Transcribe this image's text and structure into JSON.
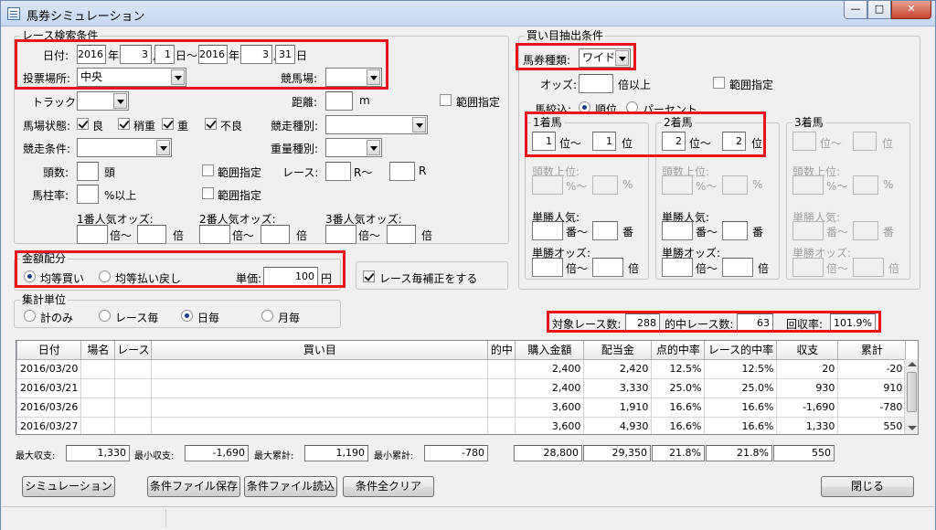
{
  "window": {
    "title": "馬券シミュレーション",
    "min": "—",
    "max": "□",
    "close": "✕"
  },
  "race_search": {
    "title": "レース検索条件",
    "date_label": "日付:",
    "from_year": "2016",
    "year_unit": "年",
    "from_month": "3",
    "month_unit": "月",
    "from_day": "1",
    "day_unit_tilde": "日〜",
    "to_year": "2016",
    "to_month": "3",
    "to_day": "31",
    "day_unit": "日",
    "venue_label": "投票場所:",
    "venue_value": "中央",
    "course_label": "競馬場:",
    "course_value": "",
    "track_label": "トラック:",
    "track_value": "",
    "distance_label": "距離:",
    "distance_value": "",
    "distance_unit": "m",
    "range_label": "範囲指定",
    "condition_label": "馬場状態:",
    "cond_good": "良",
    "cond_slightly": "稍重",
    "cond_heavy": "重",
    "cond_bad": "不良",
    "race_type_label": "競走種別:",
    "race_type_value": "",
    "race_cond_label": "競走条件:",
    "race_cond_value": "",
    "weight_type_label": "重量種別:",
    "weight_type_value": "",
    "heads_label": "頭数:",
    "heads_value": "",
    "heads_unit": "頭",
    "heads_range": "範囲指定",
    "race_label": "レース:",
    "race_from": "",
    "race_r_tilde": "R〜",
    "race_to": "",
    "race_r": "R",
    "post_rate_label": "馬柱率:",
    "post_rate_value": "",
    "post_rate_unit": "%以上",
    "post_range": "範囲指定",
    "fav1_label": "1番人気オッズ:",
    "fav2_label": "2番人気オッズ:",
    "fav3_label": "3番人気オッズ:",
    "bai_tilde": "倍〜",
    "bai": "倍"
  },
  "amount": {
    "title": "金額配分",
    "equal_buy": "均等買い",
    "equal_payout": "均等払い戻し",
    "unit_label": "単価:",
    "unit_value": "100",
    "yen": "円"
  },
  "race_correction": "レース毎補正をする",
  "aggregate": {
    "title": "集計単位",
    "total_only": "計のみ",
    "per_race": "レース毎",
    "per_day": "日毎",
    "per_month": "月毎"
  },
  "bet_extract": {
    "title": "買い目抽出条件",
    "bet_type_label": "馬券種類:",
    "bet_type_value": "ワイド",
    "odds_label": "オッズ:",
    "odds_value": "",
    "odds_unit": "倍以上",
    "range_label": "範囲指定",
    "horse_pick_label": "馬絞込:",
    "by_rank": "順位",
    "by_percent": "パーセント",
    "place1": {
      "title": "1着馬",
      "from": "1",
      "to": "1"
    },
    "place2": {
      "title": "2着馬",
      "from": "2",
      "to": "2"
    },
    "place3": {
      "title": "3着馬",
      "from": "",
      "to": ""
    },
    "rank_tilde": "位〜",
    "rank": "位",
    "heads_top": "頭数上位:",
    "pct_tilde": "%〜",
    "pct": "%",
    "win_fav": "単勝人気:",
    "ban_tilde": "番〜",
    "ban": "番",
    "win_odds": "単勝オッズ:"
  },
  "summary": {
    "target_label": "対象レース数:",
    "target_value": "288",
    "hit_label": "的中レース数:",
    "hit_value": "63",
    "recovery_label": "回収率:",
    "recovery_value": "101.9%"
  },
  "table": {
    "headers": [
      "日付",
      "場名",
      "レース",
      "買い目",
      "的中",
      "購入金額",
      "配当金",
      "点的中率",
      "レース的中率",
      "収支",
      "累計"
    ],
    "rows": [
      [
        "2016/03/20",
        "",
        "",
        "",
        "",
        "2,400",
        "2,420",
        "12.5%",
        "12.5%",
        "20",
        "-20"
      ],
      [
        "2016/03/21",
        "",
        "",
        "",
        "",
        "2,400",
        "3,330",
        "25.0%",
        "25.0%",
        "930",
        "910"
      ],
      [
        "2016/03/26",
        "",
        "",
        "",
        "",
        "3,600",
        "1,910",
        "16.6%",
        "16.6%",
        "-1,690",
        "-780"
      ],
      [
        "2016/03/27",
        "",
        "",
        "",
        "",
        "3,600",
        "4,930",
        "16.6%",
        "16.6%",
        "1,330",
        "550"
      ]
    ]
  },
  "footer_stats": {
    "max_balance_label": "最大収支:",
    "max_balance": "1,330",
    "min_balance_label": "最小収支:",
    "min_balance": "-1,690",
    "max_cum_label": "最大累計:",
    "max_cum": "1,190",
    "min_cum_label": "最小累計:",
    "min_cum": "-780",
    "total_buy": "28,800",
    "total_pay": "29,350",
    "point_rate": "21.8%",
    "race_rate": "21.8%",
    "total_balance": "550"
  },
  "buttons": {
    "simulate": "シミュレーション",
    "save": "条件ファイル保存",
    "load": "条件ファイル読込",
    "clear": "条件全クリア",
    "close": "閉じる"
  }
}
